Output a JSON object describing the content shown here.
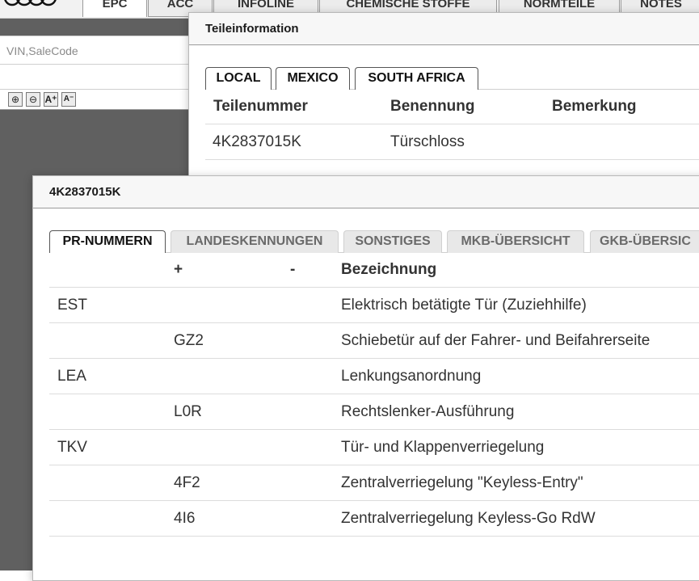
{
  "app": {
    "main_tabs": [
      "EPC",
      "ACC",
      "INFOLINE",
      "CHEMISCHE STOFFE",
      "NORMTEILE",
      "NOTES"
    ],
    "active_main_tab": "EPC",
    "search": {
      "placeholder": "VIN,SaleCode",
      "value": ""
    },
    "zoom_tools": [
      "zoom-in-icon",
      "zoom-out-icon",
      "font-increase-icon",
      "font-decrease-icon"
    ],
    "colors": {
      "left_panel": "#606060",
      "accent_border": "#555555"
    }
  },
  "teileinformation": {
    "title": "Teileinformation",
    "tabs": [
      "LOCAL",
      "MEXICO",
      "SOUTH AFRICA"
    ],
    "active_tab": "LOCAL",
    "columns": [
      "Teilenummer",
      "Benennung",
      "Bemerkung"
    ],
    "rows": [
      {
        "teilenummer": "4K2837015K",
        "benennung": "Türschloss",
        "bemerkung": ""
      }
    ]
  },
  "part_detail": {
    "title": "4K2837015K",
    "tabs": [
      "PR-NUMMERN",
      "LANDESKENNUNGEN",
      "SONSTIGES",
      "MKB-ÜBERSICHT",
      "GKB-ÜBERSIC"
    ],
    "active_tab": "PR-NUMMERN",
    "columns": [
      "",
      "+",
      "-",
      "Bezeichnung"
    ],
    "rows": [
      {
        "group": "EST",
        "plus": "",
        "minus": "",
        "bezeichnung": "Elektrisch betätigte Tür (Zuziehhilfe)"
      },
      {
        "group": "",
        "plus": "GZ2",
        "minus": "",
        "bezeichnung": "Schiebetür auf der Fahrer- und Beifahrerseite"
      },
      {
        "group": "LEA",
        "plus": "",
        "minus": "",
        "bezeichnung": "Lenkungsanordnung"
      },
      {
        "group": "",
        "plus": "L0R",
        "minus": "",
        "bezeichnung": "Rechtslenker-Ausführung"
      },
      {
        "group": "TKV",
        "plus": "",
        "minus": "",
        "bezeichnung": "Tür- und Klappenverriegelung"
      },
      {
        "group": "",
        "plus": "4F2",
        "minus": "",
        "bezeichnung": "Zentralverriegelung \"Keyless-Entry\""
      },
      {
        "group": "",
        "plus": "4I6",
        "minus": "",
        "bezeichnung": "Zentralverriegelung Keyless-Go RdW"
      }
    ]
  }
}
